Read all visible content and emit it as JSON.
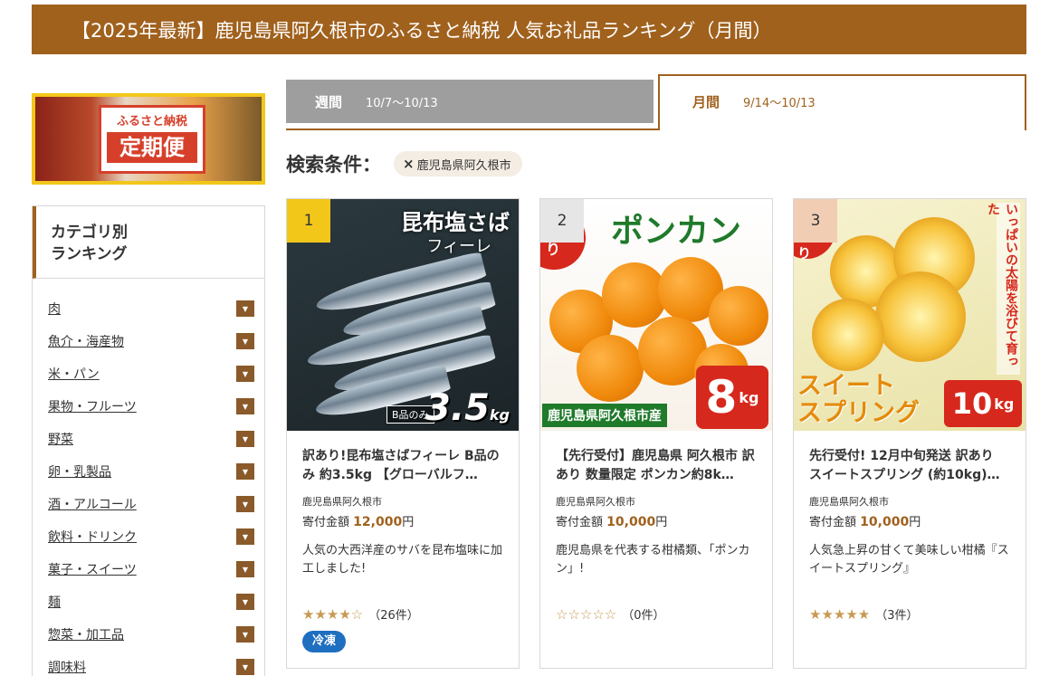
{
  "page_title": "【2025年最新】鹿児島県阿久根市のふるさと納税 人気お礼品ランキング（月間）",
  "banner": {
    "small": "ふるさと納税",
    "big": "定期便"
  },
  "sidebar": {
    "heading_line1": "カテゴリ別",
    "heading_line2": "ランキング",
    "toggle_glyph": "▼",
    "items": [
      {
        "label": "肉"
      },
      {
        "label": "魚介・海産物"
      },
      {
        "label": "米・パン"
      },
      {
        "label": "果物・フルーツ"
      },
      {
        "label": "野菜"
      },
      {
        "label": "卵・乳製品"
      },
      {
        "label": "酒・アルコール"
      },
      {
        "label": "飲料・ドリンク"
      },
      {
        "label": "菓子・スイーツ"
      },
      {
        "label": "麺"
      },
      {
        "label": "惣菜・加工品"
      },
      {
        "label": "調味料"
      }
    ]
  },
  "tabs": {
    "week": {
      "title": "週間",
      "dates": "10/7〜10/13",
      "active": false
    },
    "month": {
      "title": "月間",
      "dates": "9/14〜10/13",
      "active": true
    }
  },
  "search": {
    "label": "検索条件：",
    "chip_x": "×",
    "chip_text": "鹿児島県阿久根市"
  },
  "colors": {
    "brand": "#a0611d",
    "rank1": "#f2c71a",
    "rank2": "#e6e6e6",
    "rank3": "#f1cdb4",
    "tag": "#1e6fc0"
  },
  "cards": [
    {
      "rank": "1",
      "title": "訳あり!昆布塩さばフィーレ B品のみ 約3.5kg 【グローバルフ…",
      "municipality": "鹿児島県阿久根市",
      "price_label": "寄付金額",
      "price": "12,000",
      "price_unit": "円",
      "description": "人気の大西洋産のサバを昆布塩味に加工しました!",
      "rating": 4.5,
      "stars": "★★★★☆",
      "reviews": "（26件）",
      "tag": "冷凍",
      "image": {
        "headline": "昆布塩さば",
        "sub": "フィーレ",
        "weight": "3.5",
        "unit": "kg",
        "note": "B品のみ"
      }
    },
    {
      "rank": "2",
      "title": "【先行受付】鹿児島県 阿久根市 訳あり 数量限定 ポンカン約8k…",
      "municipality": "鹿児島県阿久根市",
      "price_label": "寄付金額",
      "price": "10,000",
      "price_unit": "円",
      "description": "鹿児島県を代表する柑橘類、「ポンカン」!",
      "rating": 0,
      "stars": "☆☆☆☆☆",
      "reviews": "（0件）",
      "image": {
        "headline": "ポンカン",
        "badge": "訳あり",
        "place": "鹿児島県阿久根市産",
        "weight": "8",
        "unit": "kg"
      }
    },
    {
      "rank": "3",
      "title": "先行受付! 12月中旬発送 訳あり スイートスプリング (約10kg)…",
      "municipality": "鹿児島県阿久根市",
      "price_label": "寄付金額",
      "price": "10,000",
      "price_unit": "円",
      "description": "人気急上昇の甘くて美味しい柑橘『スイートスプリング』",
      "rating": 5,
      "stars": "★★★★★",
      "reviews": "（3件）",
      "image": {
        "badge": "訳あり",
        "vertical": "いっぱいの太陽を浴びて育った",
        "name1": "スイート",
        "name2": "スプリング",
        "weight": "10",
        "unit": "kg"
      }
    }
  ]
}
